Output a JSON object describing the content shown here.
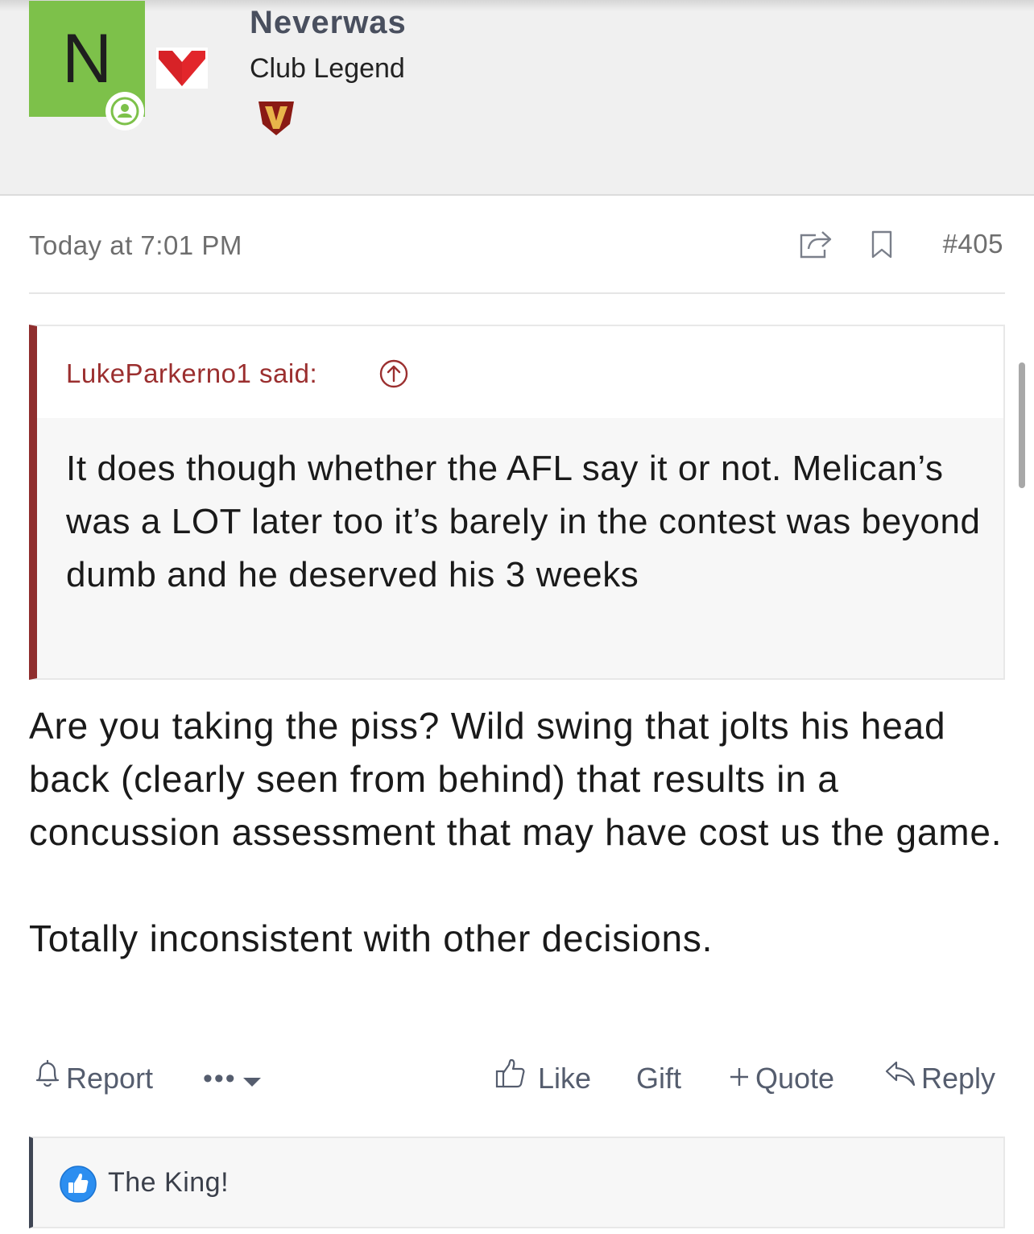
{
  "user": {
    "avatar_letter": "N",
    "avatar_color": "#7dc14a",
    "name": "Neverwas",
    "title": "Club Legend",
    "online_icon": "person-icon",
    "flag_icon": "heart-icon",
    "badge_icon": "v-badge-icon",
    "badge_letter": "V"
  },
  "post": {
    "date": "Today at 7:01 PM",
    "number": "#405",
    "share_icon": "share-icon",
    "bookmark_icon": "bookmark-icon"
  },
  "quote": {
    "author_said": "LukeParkerno1 said:",
    "jump_icon": "arrow-up-circle-icon",
    "text": "It does though whether the AFL say it or not. Melican’s was a LOT later too it’s barely in the contest was beyond dumb and he deserved his 3 weeks",
    "accent_color": "#8f2e2e"
  },
  "body": {
    "paragraphs": [
      "Are you taking the piss? Wild swing that jolts his head back (clearly seen from behind) that results in a concussion assessment that may have cost us the game.",
      "Totally inconsistent with other decisions."
    ]
  },
  "actions": {
    "report": "Report",
    "more": "•••",
    "like": "Like",
    "gift": "Gift",
    "quote": "Quote",
    "reply": "Reply"
  },
  "reactions": {
    "icon": "thumbs-up-icon",
    "users": "The King!"
  }
}
